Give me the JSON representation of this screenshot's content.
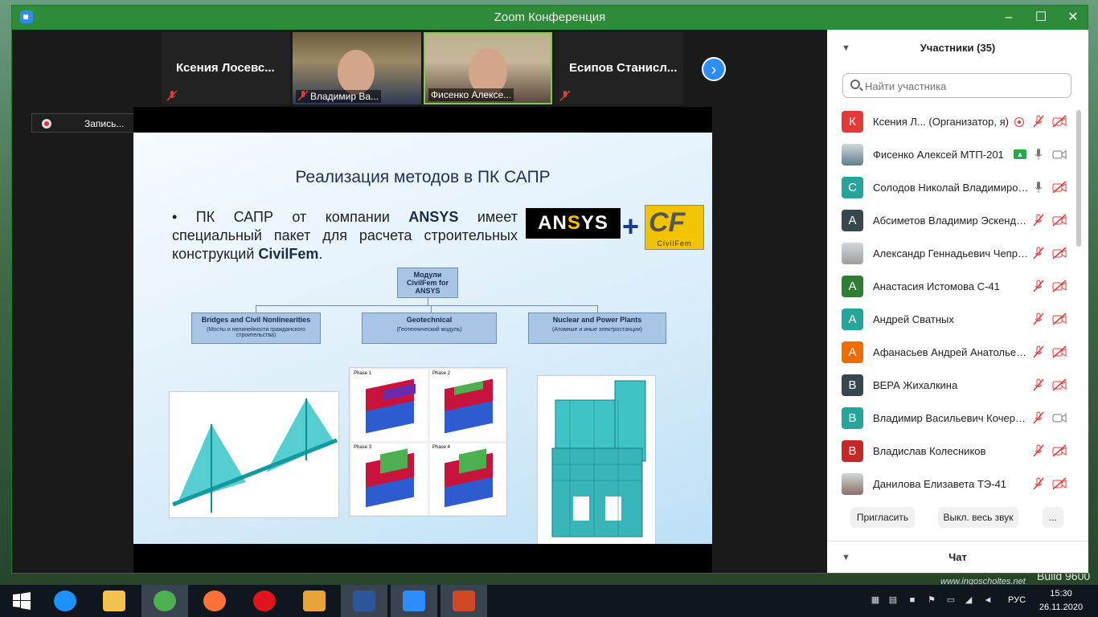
{
  "window": {
    "title": "Zoom Конференция",
    "buttons": {
      "minimize": "–",
      "maximize": "☐",
      "close": "✕"
    }
  },
  "video_strip": {
    "tiles": [
      {
        "name": "Ксения  Лосевс...",
        "muted": true
      },
      {
        "name": "Владимир Ва...",
        "muted": true
      },
      {
        "name": "Фисенко Алексе...",
        "muted": false
      },
      {
        "name": "Есипов  Станисл...",
        "muted": true
      }
    ],
    "next_icon": "›"
  },
  "recording": {
    "label": "Запись..."
  },
  "slide": {
    "title": "Реализация методов в ПК САПР",
    "bullet": {
      "t1": "ПК САПР от компании ",
      "b1": "ANSYS",
      "t2": " имеет специальный пакет для расчета строительных конструкций ",
      "b2": "CivilFem",
      "t3": "."
    },
    "logo_ansys": {
      "a": "AN",
      "s": "S",
      "b": "YS"
    },
    "logo_plus": "+",
    "logo_cf": {
      "letters": "CF",
      "caption": "CivilFem"
    },
    "root_box": "Модули CivilFem for ANSYS",
    "modules": [
      {
        "title": "Bridges and Civil Nonlinearities",
        "sub": "(Мосты и нелинейности гражданского строительства)"
      },
      {
        "title": "Geotechnical",
        "sub": "(Геотехнический модуль)"
      },
      {
        "title": "Nuclear and Power Plants",
        "sub": "(Атомные и иные электростанции)"
      }
    ],
    "phases": [
      "Phase 1",
      "Phase 2",
      "Phase 3",
      "Phase 4"
    ]
  },
  "participants": {
    "header": "Участники (35)",
    "search_placeholder": "Найти участника",
    "list": [
      {
        "initial": "К",
        "color": "#e53935",
        "name": "Ксения  Л...  (Организатор, я)",
        "mic": "muted",
        "cam": "off",
        "rec": true,
        "photo": false
      },
      {
        "initial": "",
        "color": "#607d8b",
        "name": "Фисенко Алексей МТП-201",
        "mic": "on",
        "cam": "on",
        "share": true,
        "photo": true
      },
      {
        "initial": "С",
        "color": "#26a69a",
        "name": "Солодов Николай Владимиров...",
        "mic": "on",
        "cam": "off",
        "photo": false
      },
      {
        "initial": "А",
        "color": "#37474f",
        "name": "Абсиметов Владимир Эскенде...",
        "mic": "muted",
        "cam": "off",
        "photo": false
      },
      {
        "initial": "",
        "color": "#9e9e9e",
        "name": "Александр Геннадьевич Чепра...",
        "mic": "muted",
        "cam": "off",
        "photo": true
      },
      {
        "initial": "А",
        "color": "#2e7d32",
        "name": "Анастасия Истомова С-41",
        "mic": "muted",
        "cam": "off",
        "photo": false
      },
      {
        "initial": "А",
        "color": "#26a69a",
        "name": "Андрей Сватных",
        "mic": "muted",
        "cam": "off",
        "photo": false
      },
      {
        "initial": "А",
        "color": "#ef6c00",
        "name": "Афанасьев Андрей Анатольевич",
        "mic": "muted",
        "cam": "off",
        "photo": false
      },
      {
        "initial": "В",
        "color": "#37474f",
        "name": "ВЕРА Жихалкина",
        "mic": "muted",
        "cam": "off",
        "photo": false
      },
      {
        "initial": "В",
        "color": "#26a69a",
        "name": "Владимир Васильевич Кочерж...",
        "mic": "muted",
        "cam": "on",
        "photo": false
      },
      {
        "initial": "В",
        "color": "#c62828",
        "name": "Владислав Колесников",
        "mic": "muted",
        "cam": "off",
        "photo": false
      },
      {
        "initial": "",
        "color": "#8d6e63",
        "name": "Данилова Елизавета ТЭ-41",
        "mic": "muted",
        "cam": "off",
        "photo": true
      }
    ],
    "buttons": {
      "invite": "Пригласить",
      "mute_all": "Выкл. весь звук",
      "more": "..."
    },
    "chat_header": "Чат"
  },
  "taskbar": {
    "apps": [
      {
        "name": "start-button",
        "color": "#ffffff"
      },
      {
        "name": "internet-explorer-icon",
        "color": "#1e90ff"
      },
      {
        "name": "file-explorer-icon",
        "color": "#f2c14e"
      },
      {
        "name": "chrome-icon",
        "color": "#4caf50"
      },
      {
        "name": "firefox-icon",
        "color": "#ff7139"
      },
      {
        "name": "opera-icon",
        "color": "#e0151c"
      },
      {
        "name": "notes-app-icon",
        "color": "#e8a33d"
      },
      {
        "name": "word-icon",
        "color": "#2b579a"
      },
      {
        "name": "zoom-icon",
        "color": "#2d8cff"
      },
      {
        "name": "powerpoint-icon",
        "color": "#d24726"
      }
    ],
    "lang": "РУС",
    "time": "15:30",
    "date": "26.11.2020"
  },
  "desktop": {
    "watermark": "www.ingoscholtes.net",
    "build": "Build 9600"
  }
}
